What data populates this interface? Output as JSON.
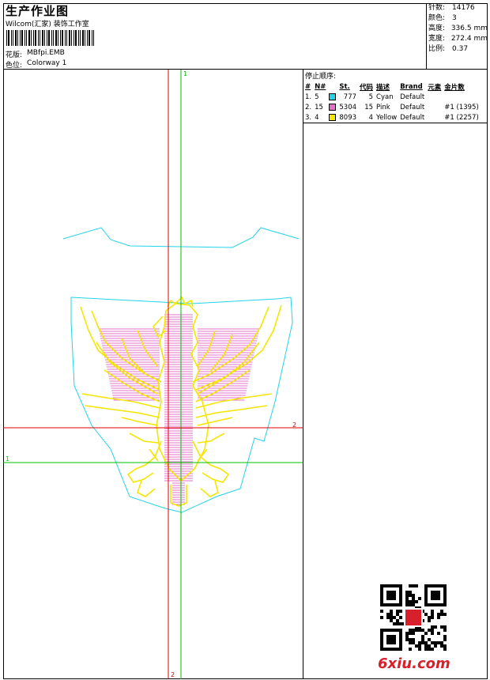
{
  "header": {
    "title": "生产作业图",
    "subtitle": "Wilcom(汇家) 装饰工作室",
    "design_label": "花版:",
    "design_value": "MBfpi.EMB",
    "colorway_label": "色位:",
    "colorway_value": "Colorway 1"
  },
  "stats": [
    {
      "label": "针数:",
      "value": "14176"
    },
    {
      "label": "颜色:",
      "value": "3"
    },
    {
      "label": "高度:",
      "value": "336.5 mm"
    },
    {
      "label": "宽度:",
      "value": "272.4 mm"
    },
    {
      "label": "比例:",
      "value": "0.37"
    }
  ],
  "stop_sequence": {
    "title": "停止顺序:",
    "columns": [
      "#",
      "N#",
      "St.",
      "代码",
      "描述",
      "Brand",
      "元素",
      "金片数"
    ],
    "rows": [
      {
        "idx": "1.",
        "n": "5",
        "color": "#22d3e8",
        "st": "777",
        "code": "5",
        "desc": "Cyan",
        "brand": "Default",
        "element": "",
        "sequins": ""
      },
      {
        "idx": "2.",
        "n": "15",
        "color": "#e070c8",
        "st": "5304",
        "code": "15",
        "desc": "Pink",
        "brand": "Default",
        "element": "",
        "sequins": "#1 (1395)"
      },
      {
        "idx": "3.",
        "n": "4",
        "color": "#f5e600",
        "st": "8093",
        "code": "4",
        "desc": "Yellow",
        "brand": "Default",
        "element": "",
        "sequins": "#1 (2257)"
      }
    ]
  },
  "guides": {
    "v_green_label": "1",
    "v_red_label": "2",
    "h_red_label": "2",
    "h_green_label": "1"
  },
  "colors": {
    "cyan": "#22d3e8",
    "pink": "#e070c8",
    "yellow": "#f5e600",
    "guide_red": "#e00000",
    "guide_green": "#00c000"
  },
  "watermark": {
    "text": "6xiu.com"
  }
}
